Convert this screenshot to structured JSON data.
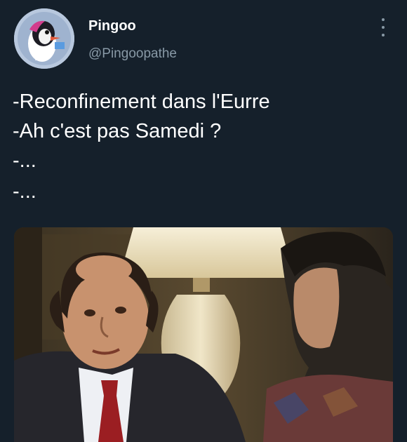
{
  "author": {
    "name": "Pingoo",
    "handle": "@Pingoopathe",
    "avatar_icon": "penguin-avatar-icon"
  },
  "menu": {
    "icon": "more-vertical-icon"
  },
  "tweet": {
    "lines": [
      "-Reconfinement dans l'Eurre",
      "-Ah c'est pas Samedi ?",
      "-...",
      "-..."
    ]
  },
  "media": {
    "description_icon": "movie-still-image"
  },
  "colors": {
    "background": "#15202b",
    "text": "#ffffff",
    "secondary_text": "#8899a6"
  }
}
